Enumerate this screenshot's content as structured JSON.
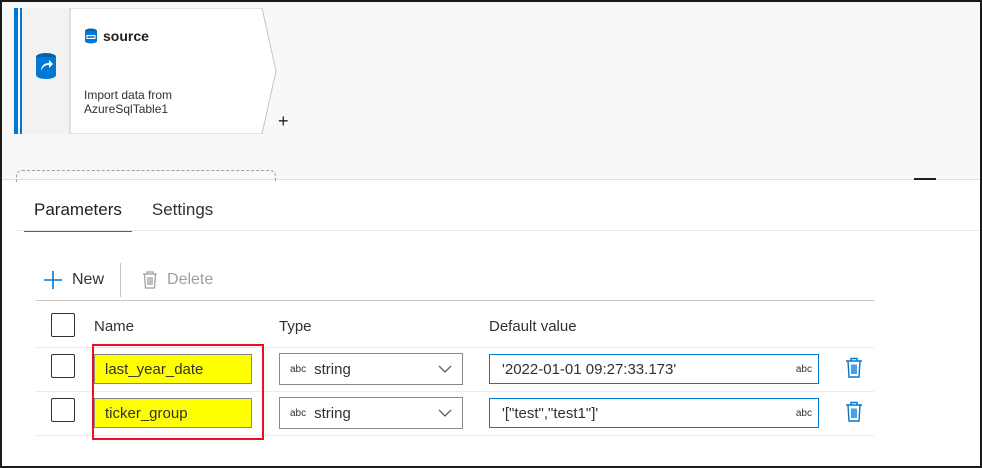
{
  "node": {
    "title": "source",
    "description_line1": "Import data from",
    "description_line2": "AzureSqlTable1",
    "add_symbol": "+",
    "icon": "sql-database-icon",
    "left_icon": "dataflow-source-icon"
  },
  "tabs": [
    {
      "label": "Parameters",
      "active": true
    },
    {
      "label": "Settings",
      "active": false
    }
  ],
  "toolbar": {
    "new_label": "New",
    "delete_label": "Delete"
  },
  "table": {
    "headers": {
      "name": "Name",
      "type": "Type",
      "default": "Default value"
    },
    "rows": [
      {
        "name": "last_year_date",
        "type_prefix": "abc",
        "type": "string",
        "default_value": "'2022-01-01 09:27:33.173'",
        "default_suffix": "abc"
      },
      {
        "name": "ticker_group",
        "type_prefix": "abc",
        "type": "string",
        "default_value": "'[\"test\",\"test1\"]'",
        "default_suffix": "abc"
      }
    ]
  },
  "colors": {
    "accent": "#0078d4",
    "highlight": "#ffff00",
    "annotation_box": "#e81123"
  }
}
